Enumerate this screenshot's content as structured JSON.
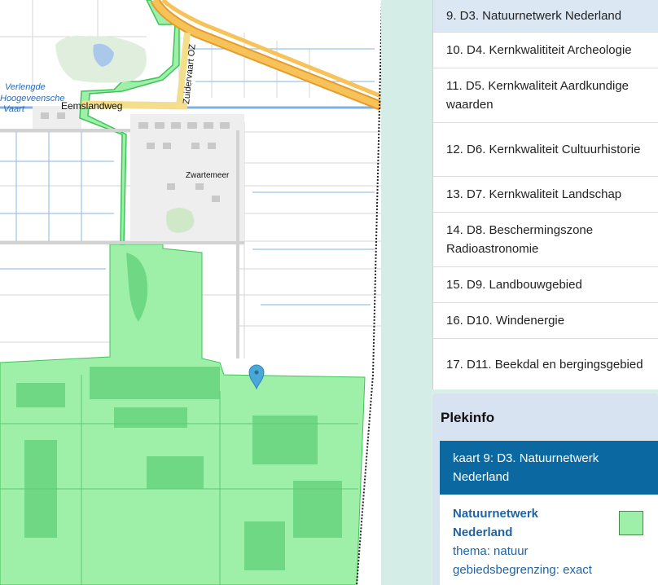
{
  "map": {
    "labels": {
      "emslandweg": "Eemslandweg",
      "zuidervaart": "Zuidervaart OZ",
      "zwartemeer": "Zwartemeer",
      "canal1": "Verlengde",
      "canal2": "Hoogeveensche",
      "canal3": "Vaart"
    },
    "colors": {
      "land": "#ffffff",
      "nature": "#9ef0a9",
      "nature_dark": "#6fd884",
      "nature_border": "#3fc25a",
      "road": "#f4b84b",
      "water": "#a9c8ea",
      "marker": "#4aa8d8"
    }
  },
  "legend": {
    "items": [
      {
        "label": "9. D3. Natuurnetwerk Nederland",
        "active": true
      },
      {
        "label": "10. D4. Kernkwalititeit Archeologie"
      },
      {
        "label": "11. D5. Kernkwaliteit Aardkundige waarden"
      },
      {
        "label": "12. D6. Kernkwaliteit Cultuurhistorie"
      },
      {
        "label": "13. D7. Kernkwaliteit Landschap"
      },
      {
        "label": "14. D8. Beschermingszone Radioastronomie"
      },
      {
        "label": "15. D9. Landbouwgebied"
      },
      {
        "label": "16. D10. Windenergie"
      },
      {
        "label": "17. D11. Beekdal en bergingsgebied"
      }
    ]
  },
  "plekinfo": {
    "title": "Plekinfo",
    "kaart": "kaart 9: D3. Natuurnetwerk Nederland",
    "feature_name": "Natuurnetwerk Nederland",
    "thema": "thema: natuur",
    "begrenzing": "gebiedsbegrenzing: exact",
    "swatch_color": "#9ef0a9"
  }
}
